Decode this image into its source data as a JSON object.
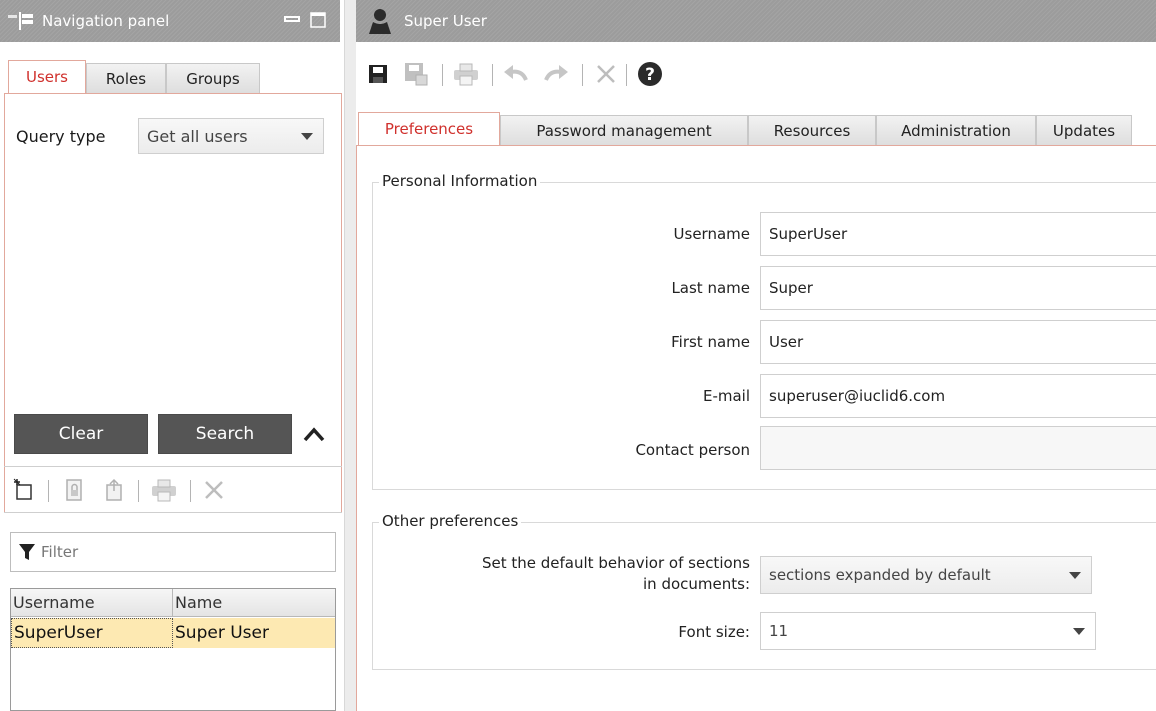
{
  "nav_panel": {
    "title": "Navigation panel",
    "tabs": [
      {
        "label": "Users",
        "active": true
      },
      {
        "label": "Roles",
        "active": false
      },
      {
        "label": "Groups",
        "active": false
      }
    ],
    "query_type_label": "Query type",
    "query_type_value": "Get all users",
    "clear_label": "Clear",
    "search_label": "Search",
    "filter_placeholder": "Filter",
    "table": {
      "columns": [
        "Username",
        "Name"
      ],
      "rows": [
        {
          "username": "SuperUser",
          "name": "Super User"
        }
      ]
    }
  },
  "main": {
    "title": "Super User",
    "tabs": [
      {
        "label": "Preferences",
        "active": true
      },
      {
        "label": "Password management",
        "active": false
      },
      {
        "label": "Resources",
        "active": false
      },
      {
        "label": "Administration",
        "active": false
      },
      {
        "label": "Updates",
        "active": false
      }
    ],
    "personal_info": {
      "legend": "Personal Information",
      "username_label": "Username",
      "username_value": "SuperUser",
      "last_name_label": "Last name",
      "last_name_value": "Super",
      "first_name_label": "First name",
      "first_name_value": "User",
      "email_label": "E-mail",
      "email_value": "superuser@iuclid6.com",
      "contact_label": "Contact person",
      "contact_value": ""
    },
    "other_prefs": {
      "legend": "Other preferences",
      "sections_label_line1": "Set the default behavior of sections",
      "sections_label_line2": "in documents:",
      "sections_value": "sections expanded by default",
      "font_size_label": "Font size:",
      "font_size_value": "11"
    }
  },
  "colors": {
    "accent_red": "#d0312d",
    "title_gray": "#a0a0a0",
    "selected_row": "#fde9b2",
    "dark_button": "#555555"
  }
}
